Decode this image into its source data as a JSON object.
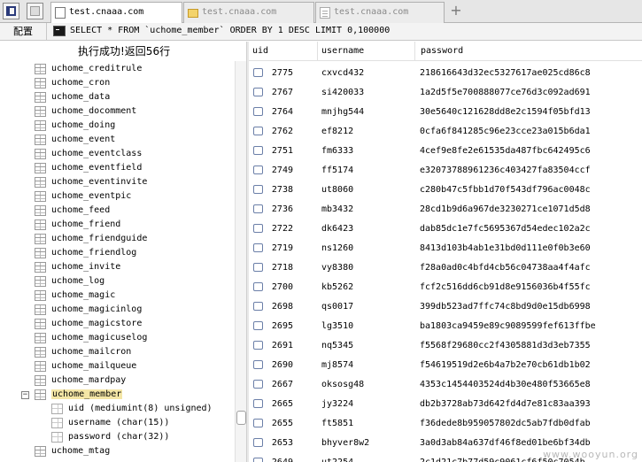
{
  "tabs": [
    {
      "label": "test.cnaaa.com",
      "icon": "database-icon",
      "active": true
    },
    {
      "label": "test.cnaaa.com",
      "icon": "folder-icon",
      "active": false
    },
    {
      "label": "test.cnaaa.com",
      "icon": "page-icon",
      "active": false
    }
  ],
  "tabbar": {
    "add": "+"
  },
  "querybar": {
    "config_label": "配置",
    "query": "SELECT * FROM `uchome_member` ORDER BY 1 DESC LIMIT 0,100000"
  },
  "status": "执行成功!返回56行",
  "tree": [
    {
      "label": "uchome_creditrule",
      "type": "table"
    },
    {
      "label": "uchome_cron",
      "type": "table"
    },
    {
      "label": "uchome_data",
      "type": "table"
    },
    {
      "label": "uchome_docomment",
      "type": "table"
    },
    {
      "label": "uchome_doing",
      "type": "table"
    },
    {
      "label": "uchome_event",
      "type": "table"
    },
    {
      "label": "uchome_eventclass",
      "type": "table"
    },
    {
      "label": "uchome_eventfield",
      "type": "table"
    },
    {
      "label": "uchome_eventinvite",
      "type": "table"
    },
    {
      "label": "uchome_eventpic",
      "type": "table"
    },
    {
      "label": "uchome_feed",
      "type": "table"
    },
    {
      "label": "uchome_friend",
      "type": "table"
    },
    {
      "label": "uchome_friendguide",
      "type": "table"
    },
    {
      "label": "uchome_friendlog",
      "type": "table"
    },
    {
      "label": "uchome_invite",
      "type": "table"
    },
    {
      "label": "uchome_log",
      "type": "table"
    },
    {
      "label": "uchome_magic",
      "type": "table"
    },
    {
      "label": "uchome_magicinlog",
      "type": "table"
    },
    {
      "label": "uchome_magicstore",
      "type": "table"
    },
    {
      "label": "uchome_magicuselog",
      "type": "table"
    },
    {
      "label": "uchome_mailcron",
      "type": "table"
    },
    {
      "label": "uchome_mailqueue",
      "type": "table"
    },
    {
      "label": "uchome_mardpay",
      "type": "table"
    },
    {
      "label": "uchome_member",
      "type": "table",
      "selected": true,
      "expanded": true,
      "toggle": "−"
    },
    {
      "label": "uid (mediumint(8) unsigned)",
      "type": "column"
    },
    {
      "label": "username (char(15))",
      "type": "column"
    },
    {
      "label": "password (char(32))",
      "type": "column"
    },
    {
      "label": "uchome_mtag",
      "type": "table"
    }
  ],
  "grid": {
    "columns": [
      "uid",
      "username",
      "password"
    ],
    "rows": [
      [
        "2775",
        "cxvcd432",
        "218616643d32ec5327617ae025cd86c8"
      ],
      [
        "2767",
        "si420033",
        "1a2d5f5e700888077ce76d3c092ad691"
      ],
      [
        "2764",
        "mnjhg544",
        "30e5640c121628dd8e2c1594f05bfd13"
      ],
      [
        "2762",
        "ef8212",
        "0cfa6f841285c96e23cce23a015b6da1"
      ],
      [
        "2751",
        "fm6333",
        "4cef9e8fe2e61535da487fbc642495c6"
      ],
      [
        "2749",
        "ff5174",
        "e32073788961236c403427fa83504ccf"
      ],
      [
        "2738",
        "ut8060",
        "c280b47c5fbb1d70f543df796ac0048c"
      ],
      [
        "2736",
        "mb3432",
        "28cd1b9d6a967de3230271ce1071d5d8"
      ],
      [
        "2722",
        "dk6423",
        "dab85dc1e7fc5695367d54edec102a2c"
      ],
      [
        "2719",
        "ns1260",
        "8413d103b4ab1e31bd0d111e0f0b3e60"
      ],
      [
        "2718",
        "vy8380",
        "f28a0ad0c4bfd4cb56c04738aa4f4afc"
      ],
      [
        "2700",
        "kb5262",
        "fcf2c516dd6cb91d8e9156036b4f55fc"
      ],
      [
        "2698",
        "qs0017",
        "399db523ad7ffc74c8bd9d0e15db6998"
      ],
      [
        "2695",
        "lg3510",
        "ba1803ca9459e89c9089599fef613ffbe"
      ],
      [
        "2691",
        "nq5345",
        "f5568f29680cc2f4305881d3d3eb7355"
      ],
      [
        "2690",
        "mj8574",
        "f54619519d2e6b4a7b2e70cb61db1b02"
      ],
      [
        "2667",
        "oksosg48",
        "4353c1454403524d4b30e480f53665e8"
      ],
      [
        "2665",
        "jy3224",
        "db2b3728ab73d642fd4d7e81c83aa393"
      ],
      [
        "2655",
        "ft5851",
        "f36dede8b959057802dc5ab7fdb0dfab"
      ],
      [
        "2653",
        "bhyver8w2",
        "3a0d3ab84a637df46f8ed01be6bf34db"
      ],
      [
        "2649",
        "ut2254",
        "2c1d21c7b77d59c9061cf6f50c7054b"
      ]
    ]
  },
  "watermark": "www.wooyun.org"
}
